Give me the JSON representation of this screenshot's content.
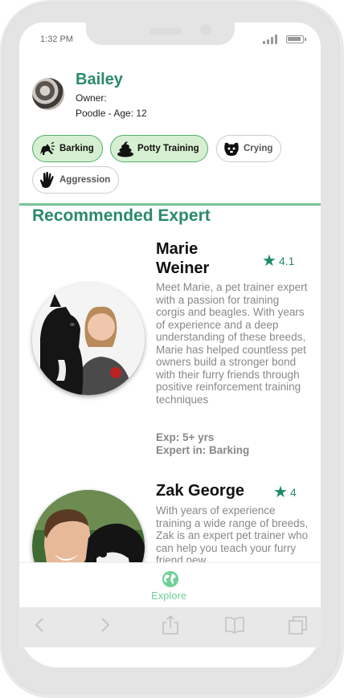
{
  "status": {
    "time": "1:32 PM"
  },
  "pet": {
    "name": "Bailey",
    "owner_label": "Owner:",
    "meta": "Poodle - Age: 12"
  },
  "tags": [
    {
      "label": "Barking",
      "active": true,
      "icon": "barking-dog-icon"
    },
    {
      "label": "Potty Training",
      "active": true,
      "icon": "poop-icon"
    },
    {
      "label": "Crying",
      "active": false,
      "icon": "sad-dog-icon"
    },
    {
      "label": "Aggression",
      "active": false,
      "icon": "hand-stop-icon"
    }
  ],
  "section_title": "Recommended Expert",
  "experts": [
    {
      "name_line1": "Marie",
      "name_line2": "Weiner",
      "rating": "4.1",
      "bio": "Meet Marie, a pet trainer expert with a passion for training corgis and beagles. With years of experience and a deep understanding of these breeds, Marie has helped countless pet owners build a stronger bond with their furry friends through positive reinforcement training techniques",
      "experience": "Exp: 5+ yrs",
      "expertise": "Expert in: Barking"
    },
    {
      "name_line1": "Zak George",
      "rating": "4",
      "bio": "With years of experience training a wide range of breeds, Zak is an expert pet trainer who can help you teach your furry friend new"
    }
  ],
  "nav": {
    "explore_label": "Explore"
  },
  "colors": {
    "accent": "#2a8a6a",
    "tag_active_bg": "#d6efd1",
    "divider": "#78c495",
    "explore": "#6fcf97"
  }
}
